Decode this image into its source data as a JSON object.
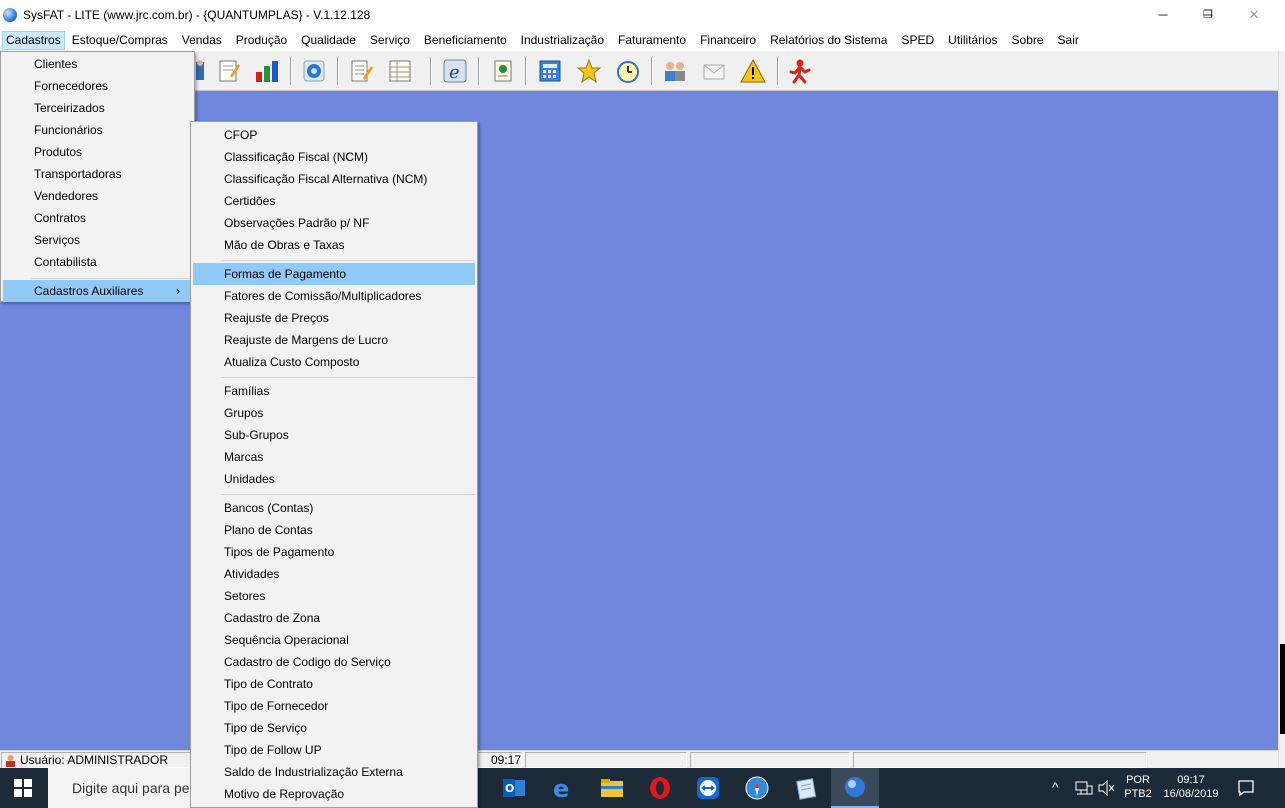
{
  "window": {
    "title": "SysFAT - LITE (www.jrc.com.br) - {QUANTUMPLAS} - V.1.12.128",
    "controls": [
      "─",
      "❐",
      "✕"
    ]
  },
  "menubar": [
    "Cadastros",
    "Estoque/Compras",
    "Vendas",
    "Produção",
    "Qualidade",
    "Serviço",
    "Beneficiamento",
    "Industrialização",
    "Faturamento",
    "Financeiro",
    "Relatórios do Sistema",
    "SPED",
    "Utilitários",
    "Sobre",
    "Sair"
  ],
  "cadastros_menu": {
    "items": [
      "Clientes",
      "Fornecedores",
      "Terceirizados",
      "Funcionários",
      "Produtos",
      "Transportadoras",
      "Vendedores",
      "Contratos",
      "Serviços",
      "Contabilista"
    ],
    "submenu_item": "Cadastros Auxiliares",
    "submenu_arrow": "›"
  },
  "auxiliares_menu": {
    "group1": [
      "CFOP",
      "Classificação Fiscal (NCM)",
      "Classificação Fiscal Alternativa (NCM)",
      "Certidões",
      "Observações Padrão p/ NF",
      "Mão de Obras e Taxas"
    ],
    "group2": [
      "Formas de Pagamento",
      "Fatores de Comissão/Multiplicadores",
      "Reajuste de Preços",
      "Reajuste de Margens de Lucro",
      "Atualiza Custo Composto"
    ],
    "group3": [
      "Famílias",
      "Grupos",
      "Sub-Grupos",
      "Marcas",
      "Unidades"
    ],
    "group4": [
      "Bancos (Contas)",
      "Plano de Contas",
      "Tipos de Pagamento",
      "Atividades",
      "Setores",
      "Cadastro de Zona",
      "Sequência Operacional",
      "Cadastro de Codigo do Serviço",
      "Tipo de Contrato",
      "Tipo de Fornecedor",
      "Tipo de Serviço",
      "Tipo de Follow UP",
      "Saldo de Industrialização Externa",
      "Motivo de Reprovação"
    ],
    "highlighted": "Formas de Pagamento"
  },
  "toolbar_icons": [
    "person-icon",
    "document-icon",
    "bar-chart-icon",
    "gear-globe-icon",
    "notepad-icon",
    "table-icon",
    "e-document-icon",
    "certificate-icon",
    "calculator-icon",
    "star-icon",
    "clock-icon",
    "users-icon",
    "mail-icon",
    "warning-icon",
    "exit-person-icon"
  ],
  "statusbar": {
    "user": "Usuário: ADMINISTRADOR",
    "time": "09:17"
  },
  "taskbar": {
    "search_placeholder": "Digite aqui para pesquisar",
    "lang1": "POR",
    "lang2": "PTB2",
    "clock_time": "09:17",
    "clock_date": "16/08/2019",
    "tray_chevron": "^",
    "apps": [
      "outlook-icon",
      "edge-icon",
      "file-explorer-icon",
      "opera-icon",
      "teamviewer-icon",
      "safari-icon",
      "notepad-app-icon",
      "sysfat-app-icon"
    ]
  },
  "colors": {
    "desktop_bg": "#6f87dd",
    "highlight": "#91c9f7",
    "taskbar": "#1c2a38"
  }
}
